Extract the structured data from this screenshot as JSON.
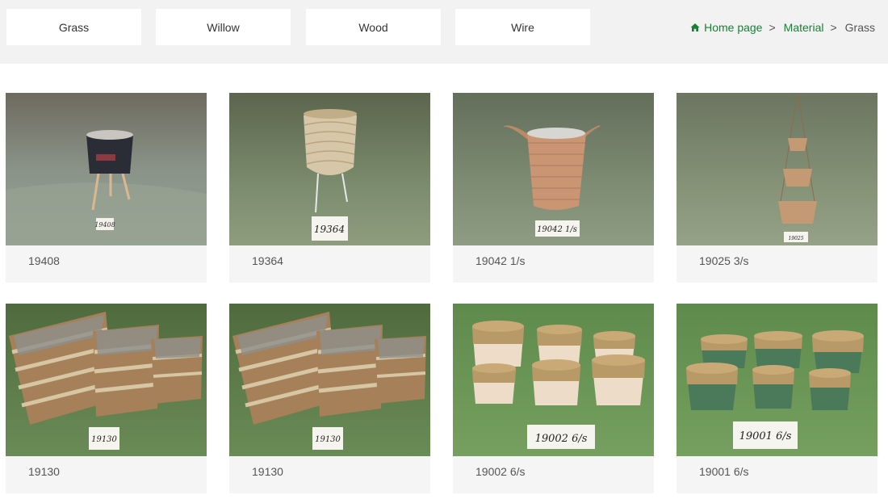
{
  "tabs": [
    {
      "label": "Grass"
    },
    {
      "label": "Willow"
    },
    {
      "label": "Wood"
    },
    {
      "label": "Wire"
    }
  ],
  "breadcrumb": {
    "home": "Home page",
    "sep1": ">",
    "material": "Material",
    "sep2": ">",
    "current": "Grass"
  },
  "products": [
    {
      "caption": "19408",
      "tag": "19408"
    },
    {
      "caption": "19364",
      "tag": "19364"
    },
    {
      "caption": "19042 1/s",
      "tag": "19042 1/s"
    },
    {
      "caption": "19025 3/s",
      "tag": "19025"
    },
    {
      "caption": "19130",
      "tag": "19130"
    },
    {
      "caption": "19130",
      "tag": "19130"
    },
    {
      "caption": "19002 6/s",
      "tag": "19002 6/s"
    },
    {
      "caption": "19001 6/s",
      "tag": "19001 6/s"
    }
  ],
  "colors": {
    "accent_green": "#1a7f37",
    "topbar_bg": "#f2f2f2",
    "card_bg": "#f5f5f5",
    "photo_backdrop_gray": "#7c8a74",
    "photo_backdrop_green": "#6f9660"
  },
  "icons": {
    "home": "home-icon"
  }
}
